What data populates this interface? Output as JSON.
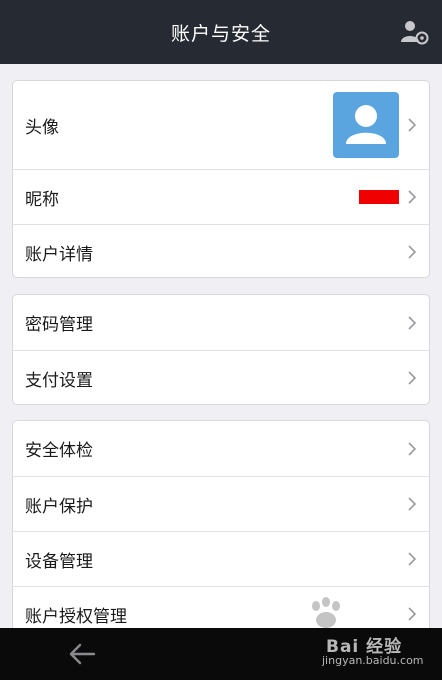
{
  "header": {
    "title": "账户与安全",
    "action_icon": "user-settings-icon"
  },
  "groups": [
    {
      "items": [
        {
          "label": "头像",
          "value_type": "avatar"
        },
        {
          "label": "昵称",
          "value_type": "redacted"
        },
        {
          "label": "账户详情"
        }
      ]
    },
    {
      "items": [
        {
          "label": "密码管理"
        },
        {
          "label": "支付设置"
        }
      ]
    },
    {
      "items": [
        {
          "label": "安全体检"
        },
        {
          "label": "账户保护"
        },
        {
          "label": "设备管理"
        },
        {
          "label": "账户授权管理"
        }
      ]
    }
  ],
  "bottom": {
    "back_icon": "back-arrow-icon"
  },
  "watermark": {
    "brand": "Bai 经验",
    "url": "jingyan.baidu.com"
  },
  "colors": {
    "header_bg": "#262a33",
    "avatar_bg": "#5aa5e0",
    "redaction": "#f00000",
    "page_bg": "#efeff4"
  }
}
